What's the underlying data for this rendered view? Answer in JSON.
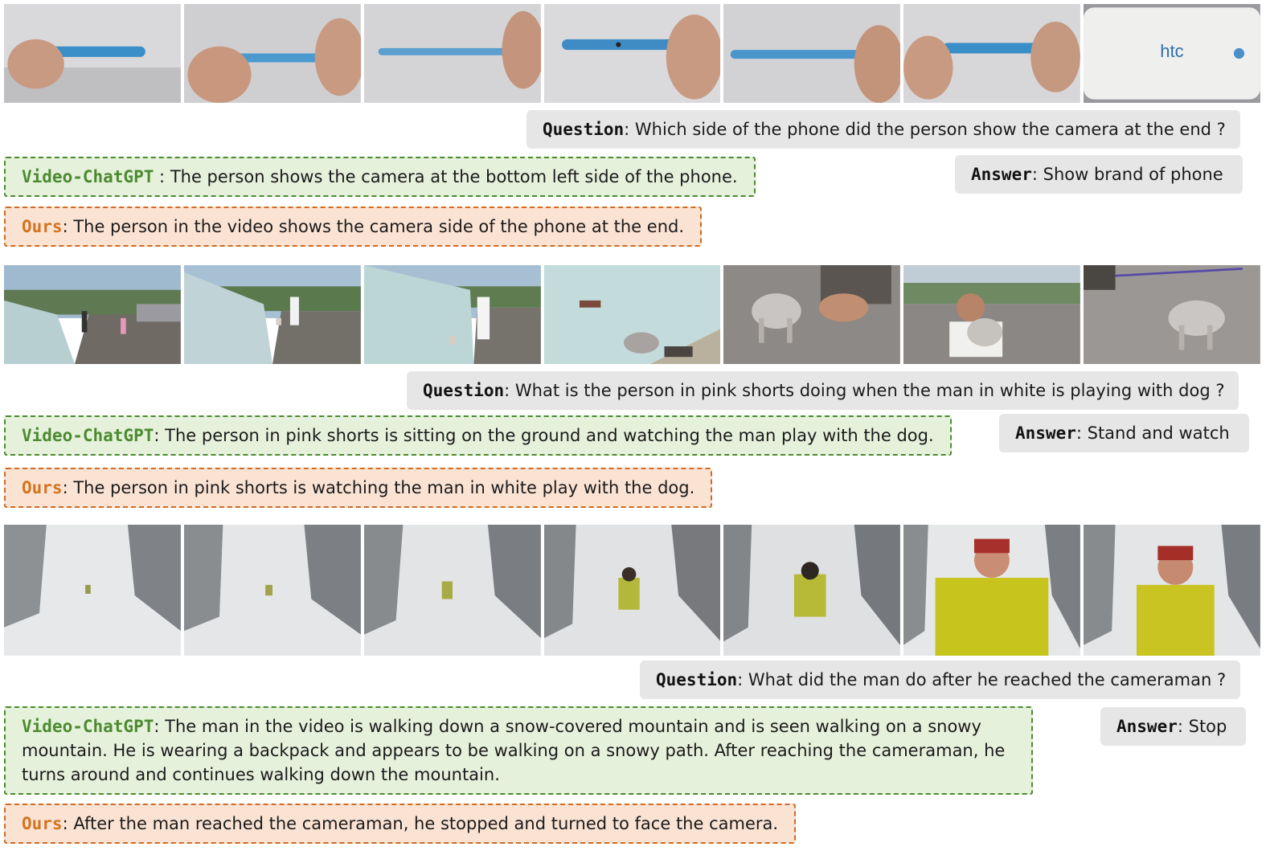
{
  "labels": {
    "question": "Question",
    "answer": "Answer",
    "baseline": "Video-ChatGPT",
    "ours": "Ours"
  },
  "examples": [
    {
      "scene": "phone",
      "question": ": Which side of the phone did the person show the camera at the end ?",
      "answer": ": Show brand of phone",
      "baseline_sep": " : ",
      "baseline": "The person shows the camera at the bottom left side of the phone.",
      "ours": ": The person in the video shows the camera side of the phone at the end."
    },
    {
      "scene": "dog",
      "question": ": What is the person in pink shorts doing when the man in white is playing with dog ?",
      "answer": ": Stand and watch",
      "baseline_sep": ": ",
      "baseline": "The person in pink shorts is sitting on the ground and watching the man play with the dog.",
      "ours": ": The person in pink shorts is watching the man in white play with the dog."
    },
    {
      "scene": "snow",
      "question": ": What did the man do after he reached the cameraman ?",
      "answer": ": Stop",
      "baseline_sep": ": ",
      "baseline": "The man in the video is walking down a snow-covered mountain and is seen walking on a snowy mountain. He is wearing a backpack and appears to be walking on a snowy path. After reaching the cameraman, he turns around and continues walking down the mountain.",
      "ours": ": After the man reached the cameraman, he stopped and turned to face the camera."
    }
  ],
  "colors": {
    "baseline_border": "#4b8a2f",
    "baseline_fill": "#e6f1dc",
    "ours_border": "#cf6b22",
    "ours_fill": "#fbe3d4",
    "question_fill": "#e6e6e6"
  },
  "frames_per_row": 7
}
